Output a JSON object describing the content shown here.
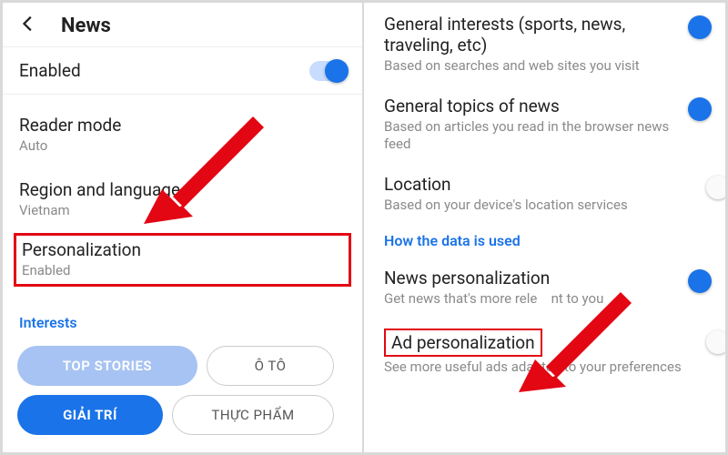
{
  "left": {
    "header_title": "News",
    "enabled": {
      "label": "Enabled",
      "on": true
    },
    "reader_mode": {
      "label": "Reader mode",
      "value": "Auto"
    },
    "region": {
      "label": "Region and language",
      "value": "Vietnam"
    },
    "personalization": {
      "label": "Personalization",
      "value": "Enabled"
    },
    "interests_label": "Interests",
    "chips": {
      "top_stories": "TOP STORIES",
      "oto": "Ô TÔ",
      "giaitri": "GIẢI TRÍ",
      "thucpham": "THỰC PHẨM"
    }
  },
  "right": {
    "general_interests": {
      "label": "General interests (sports, news, traveling, etc)",
      "sub": "Based on searches and web sites you visit",
      "on": true
    },
    "general_topics": {
      "label": "General topics of news",
      "sub": "Based on articles you read in the browser news feed",
      "on": true
    },
    "location": {
      "label": "Location",
      "sub": "Based on your device's location services",
      "on": false
    },
    "how_link": "How the data is used",
    "news_perso": {
      "label": "News personalization",
      "sub_pre": "Get news that's more rele",
      "sub_post": "nt to you",
      "on": true
    },
    "ad_perso": {
      "label": "Ad personalization",
      "sub": "See more useful ads adapted to your preferences",
      "on": false
    }
  },
  "colors": {
    "accent": "#1a73e8",
    "highlight": "#e30613"
  }
}
